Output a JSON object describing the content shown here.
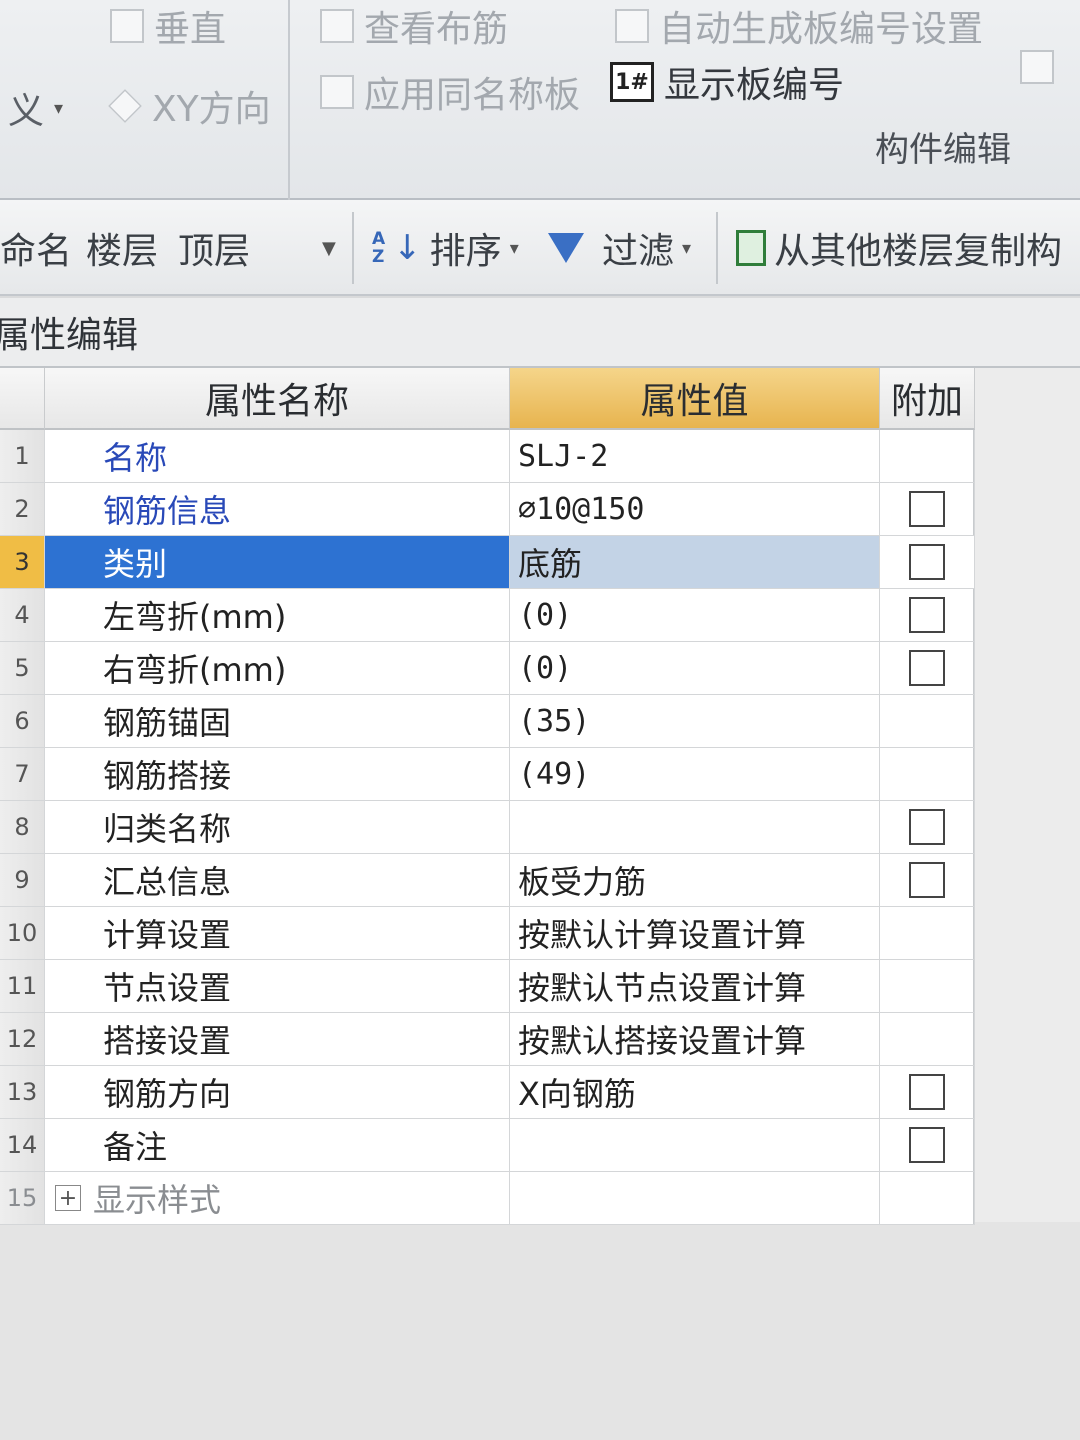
{
  "ribbon": {
    "vertical_label": "垂直",
    "view_rebar_label": "查看布筋",
    "auto_number_label": "自动生成板编号设置",
    "define_label": "义",
    "xy_dir_label": "XY方向",
    "apply_same_name_label": "应用同名称板",
    "show_board_number_label": "显示板编号",
    "board_icon_text": "1#",
    "group_component_edit": "构件编辑"
  },
  "toolbar": {
    "rename_label": "命名",
    "floor_label": "楼层",
    "floor_value": "顶层",
    "sort_label": "排序",
    "filter_label": "过滤",
    "copy_from_floor_label": "从其他楼层复制构"
  },
  "panel": {
    "title": "属性编辑"
  },
  "grid": {
    "headers": {
      "name": "属性名称",
      "value": "属性值",
      "extra": "附加"
    },
    "rows": [
      {
        "num": "1",
        "name": "名称",
        "value": "SLJ-2"
      },
      {
        "num": "2",
        "name": "钢筋信息",
        "value": "⌀10@150"
      },
      {
        "num": "3",
        "name": "类别",
        "value": "底筋"
      },
      {
        "num": "4",
        "name": "左弯折(mm)",
        "value": "(0)"
      },
      {
        "num": "5",
        "name": "右弯折(mm)",
        "value": "(0)"
      },
      {
        "num": "6",
        "name": "钢筋锚固",
        "value": "(35)"
      },
      {
        "num": "7",
        "name": "钢筋搭接",
        "value": "(49)"
      },
      {
        "num": "8",
        "name": "归类名称",
        "value": ""
      },
      {
        "num": "9",
        "name": "汇总信息",
        "value": "板受力筋"
      },
      {
        "num": "10",
        "name": "计算设置",
        "value": "按默认计算设置计算"
      },
      {
        "num": "11",
        "name": "节点设置",
        "value": "按默认节点设置计算"
      },
      {
        "num": "12",
        "name": "搭接设置",
        "value": "按默认搭接设置计算"
      },
      {
        "num": "13",
        "name": "钢筋方向",
        "value": "X向钢筋"
      },
      {
        "num": "14",
        "name": "备注",
        "value": ""
      },
      {
        "num": "15",
        "name": "显示样式",
        "value": "",
        "expander": "+"
      }
    ]
  }
}
